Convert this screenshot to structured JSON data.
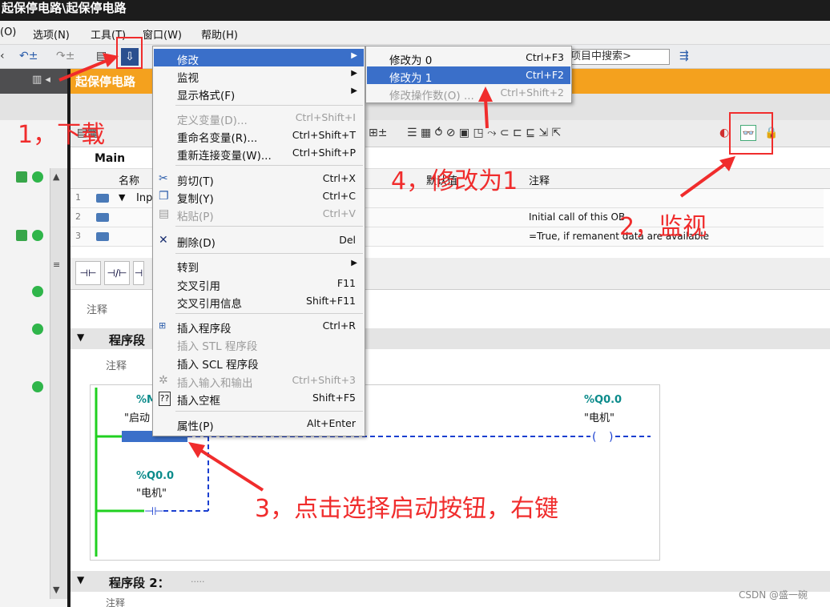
{
  "window_title": "起保停电路\\起保停电路",
  "menu": [
    "(O)",
    "选项(N)",
    "工具(T)",
    "窗口(W)",
    "帮助(H)"
  ],
  "toolbar": {
    "search_placeholder": "项目中搜索>"
  },
  "tab_title": "起保停电路",
  "block": {
    "name": "Main"
  },
  "interface": {
    "headers": [
      "名称",
      "默认值",
      "注释"
    ],
    "rows": [
      {
        "num": "1",
        "name": "Inp",
        "comment": ""
      },
      {
        "num": "2",
        "name": "",
        "comment": "Initial call of this OB"
      },
      {
        "num": "3",
        "name": "",
        "comment": "=True, if remanent data are available"
      }
    ]
  },
  "ladder_buttons": [
    "⊣⊢",
    "⊣/⊢",
    "⊣"
  ],
  "comment_label": "注释",
  "networks": [
    {
      "title": "程序段",
      "comment": "注释"
    },
    {
      "title": "程序段 2：",
      "dots": ".....",
      "comment": "注释"
    }
  ],
  "network_1": {
    "contact_start": {
      "address": "%M",
      "name": "\"启动"
    },
    "coil": {
      "address": "%Q0.0",
      "name": "\"电机\""
    },
    "contact_hold": {
      "address": "%Q0.0",
      "name": "\"电机\""
    }
  },
  "context_menu": [
    {
      "label": "修改",
      "shortcut": "",
      "arrow": true,
      "highlight": true
    },
    {
      "label": "监视",
      "shortcut": "",
      "arrow": true
    },
    {
      "label": "显示格式(F)",
      "shortcut": "",
      "arrow": true
    },
    {
      "sep": true
    },
    {
      "label": "定义变量(D)...",
      "shortcut": "Ctrl+Shift+I",
      "disabled": true
    },
    {
      "label": "重命名变量(R)...",
      "shortcut": "Ctrl+Shift+T"
    },
    {
      "label": "重新连接变量(W)...",
      "shortcut": "Ctrl+Shift+P"
    },
    {
      "sep": true
    },
    {
      "label": "剪切(T)",
      "shortcut": "Ctrl+X",
      "icon": "cut-icon"
    },
    {
      "label": "复制(Y)",
      "shortcut": "Ctrl+C",
      "icon": "copy-icon"
    },
    {
      "label": "粘贴(P)",
      "shortcut": "Ctrl+V",
      "disabled": true,
      "icon": "paste-icon"
    },
    {
      "sep": true
    },
    {
      "label": "删除(D)",
      "shortcut": "Del",
      "icon": "delete-icon"
    },
    {
      "sep": true
    },
    {
      "label": "转到",
      "shortcut": "",
      "arrow": true
    },
    {
      "label": "交叉引用",
      "shortcut": "F11"
    },
    {
      "label": "交叉引用信息",
      "shortcut": "Shift+F11"
    },
    {
      "sep": true
    },
    {
      "label": "插入程序段",
      "shortcut": "Ctrl+R",
      "icon": "insert-network-icon"
    },
    {
      "label": "插入 STL 程序段",
      "shortcut": "",
      "disabled": true
    },
    {
      "label": "插入 SCL 程序段",
      "shortcut": ""
    },
    {
      "label": "插入输入和输出",
      "shortcut": "Ctrl+Shift+3",
      "disabled": true,
      "icon": "insert-io-icon"
    },
    {
      "label": "插入空框",
      "shortcut": "Shift+F5",
      "icon": "empty-box-icon"
    },
    {
      "sep": true
    },
    {
      "label": "属性(P)",
      "shortcut": "Alt+Enter"
    }
  ],
  "submenu": [
    {
      "label": "修改为 0",
      "shortcut": "Ctrl+F3"
    },
    {
      "label": "修改为 1",
      "shortcut": "Ctrl+F2",
      "highlight": true
    },
    {
      "label": "修改操作数(O) ...",
      "shortcut": "Ctrl+Shift+2",
      "disabled": true
    }
  ],
  "annotations": {
    "step1": "1，下载",
    "step2": "2，监视",
    "step3": "3，点击选择启动按钮，右键",
    "step4": "4，修改为1",
    "color": "#f02c2c"
  },
  "watermark": "CSDN @盛一碗"
}
